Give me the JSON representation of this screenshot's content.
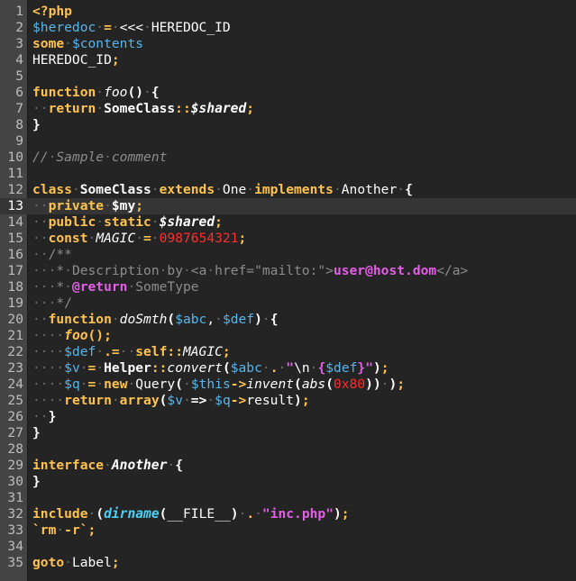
{
  "window": {
    "title": ""
  },
  "code_lines": [
    {
      "n": "1",
      "html": "<span class='kw'>&lt;?php</span>"
    },
    {
      "n": "2",
      "html": "<span class='var'>$heredoc</span><span class='ws'>·</span><span class='kw'>=</span><span class='ws'>·</span><span class='pl'>&lt;&lt;&lt;</span><span class='ws'>·</span><span class='pl'>HEREDOC_ID</span>"
    },
    {
      "n": "3",
      "html": "<span class='kw'>some</span><span class='ws'>·</span><span class='var'>$contents</span>"
    },
    {
      "n": "4",
      "html": "<span class='pl'>HEREDOC_ID</span><span class='kw'>;</span>"
    },
    {
      "n": "5",
      "html": ""
    },
    {
      "n": "6",
      "html": "<span class='kw'>function</span><span class='ws'>·</span><span class='pl it'>foo</span><span class='pl b'>()</span><span class='ws'>·</span><span class='pl b'>{</span>"
    },
    {
      "n": "7",
      "html": "<span class='ws'>··</span><span class='kw'>return</span><span class='ws'>·</span><span class='pl b'>SomeClass</span><span class='kw'>::</span><span class='pl it b'>$shared</span><span class='kw'>;</span>"
    },
    {
      "n": "8",
      "html": "<span class='pl b'>}</span>"
    },
    {
      "n": "9",
      "html": ""
    },
    {
      "n": "10",
      "html": "<span class='cm it'>//</span><span class='ws'>·</span><span class='cm it'>Sample</span><span class='ws'>·</span><span class='cm it'>comment</span>"
    },
    {
      "n": "11",
      "html": ""
    },
    {
      "n": "12",
      "html": "<span class='kw'>class</span><span class='ws'>·</span><span class='pl b'>SomeClass</span><span class='ws'>·</span><span class='kw'>extends</span><span class='ws'>·</span><span class='pl'>One</span><span class='ws'>·</span><span class='kw'>implements</span><span class='ws'>·</span><span class='pl'>Another</span><span class='ws'>·</span><span class='pl b'>{</span>"
    },
    {
      "n": "13",
      "html": "<span class='ws'>··</span><span class='kw'>private</span><span class='ws'>·</span><span class='pl b'>$my</span><span class='kw'>;</span>"
    },
    {
      "n": "14",
      "html": "<span class='ws'>··</span><span class='kw'>public</span><span class='ws'>·</span><span class='kw'>static</span><span class='ws'>·</span><span class='pl it b'>$shared</span><span class='kw'>;</span>"
    },
    {
      "n": "15",
      "html": "<span class='ws'>··</span><span class='kw'>const</span><span class='ws'>·</span><span class='pl it'>MAGIC</span><span class='ws'>·</span><span class='kw'>=</span><span class='ws'>·</span><span class='num'>0987654321</span><span class='kw'>;</span>"
    },
    {
      "n": "16",
      "html": "<span class='ws'>··</span><span class='cm'>/**</span>"
    },
    {
      "n": "17",
      "html": "<span class='ws'>···</span><span class='cm'>*</span><span class='ws'>·</span><span class='cm'>Description</span><span class='ws'>·</span><span class='cm'>by</span><span class='ws'>·</span><span class='cm'>&lt;a</span><span class='ws'>·</span><span class='cm'>href=\"mailto:\"&gt;</span><span class='str'>user@host.dom</span><span class='cm'>&lt;/a&gt;</span>"
    },
    {
      "n": "18",
      "html": "<span class='ws'>···</span><span class='cm'>*</span><span class='ws'>·</span><span class='str'>@return</span><span class='ws'>·</span><span class='cm'>SomeType</span>"
    },
    {
      "n": "19",
      "html": "<span class='ws'>···</span><span class='cm'>*/</span>"
    },
    {
      "n": "20",
      "html": "<span class='ws'>··</span><span class='kw'>function</span><span class='ws'>·</span><span class='pl it'>doSmth</span><span class='pl b'>(</span><span class='var'>$abc</span><span class='pl'>,</span><span class='ws'>·</span><span class='var'>$def</span><span class='pl b'>)</span><span class='ws'>·</span><span class='pl b'>{</span>"
    },
    {
      "n": "21",
      "html": "<span class='ws'>····</span><span class='kw it'>foo</span><span class='kw'>();</span>"
    },
    {
      "n": "22",
      "html": "<span class='ws'>····</span><span class='var'>$def</span><span class='ws'>·</span><span class='kw'>.=</span><span class='ws'>··</span><span class='kw'>self::</span><span class='pl it'>MAGIC</span><span class='kw'>;</span>"
    },
    {
      "n": "23",
      "html": "<span class='ws'>····</span><span class='var'>$v</span><span class='ws'>·</span><span class='kw'>=</span><span class='ws'>·</span><span class='pl b'>Helper</span><span class='kw'>::</span><span class='pl it'>convert</span><span class='pl b'>(</span><span class='var'>$abc</span><span class='ws'>·</span><span class='kw'>.</span><span class='ws'>·</span><span class='str'>\"</span><span class='pl'>\\n</span><span class='ws'>·</span><span class='str'>{</span><span class='var'>$def</span><span class='str'>}\"</span><span class='pl b'>)</span><span class='kw'>;</span>"
    },
    {
      "n": "24",
      "html": "<span class='ws'>····</span><span class='var'>$q</span><span class='ws'>·</span><span class='kw'>=</span><span class='ws'>·</span><span class='kw'>new</span><span class='ws'>·</span><span class='pl'>Query</span><span class='pl b'>(</span><span class='ws'>·</span><span class='var'>$this</span><span class='kw'>-&gt;</span><span class='pl it'>invent</span><span class='pl b'>(</span><span class='pl it'>abs</span><span class='pl b'>(</span><span class='num'>0x80</span><span class='pl b'>))</span><span class='ws'>·</span><span class='pl b'>)</span><span class='kw'>;</span>"
    },
    {
      "n": "25",
      "html": "<span class='ws'>····</span><span class='kw'>return</span><span class='ws'>·</span><span class='kw'>array</span><span class='pl b'>(</span><span class='var'>$v</span><span class='ws'>·</span><span class='pl b'>=&gt;</span><span class='ws'>·</span><span class='var'>$q</span><span class='kw'>-&gt;</span><span class='pl'>result</span><span class='pl b'>)</span><span class='kw'>;</span>"
    },
    {
      "n": "26",
      "html": "<span class='ws'>··</span><span class='pl b'>}</span>"
    },
    {
      "n": "27",
      "html": "<span class='pl b'>}</span>"
    },
    {
      "n": "28",
      "html": ""
    },
    {
      "n": "29",
      "html": "<span class='kw'>interface</span><span class='ws'>·</span><span class='pl it b'>Another</span><span class='ws'>·</span><span class='pl b'>{</span>"
    },
    {
      "n": "30",
      "html": "<span class='pl b'>}</span>"
    },
    {
      "n": "31",
      "html": ""
    },
    {
      "n": "32",
      "html": "<span class='kw'>include</span><span class='ws'>·</span><span class='pl b'>(</span><span class='fn it'>dirname</span><span class='pl b'>(</span><span class='pl'>__FILE__</span><span class='pl b'>)</span><span class='ws'>·</span><span class='kw'>.</span><span class='ws'>·</span><span class='str'>\"inc.php\"</span><span class='pl b'>)</span><span class='kw'>;</span>"
    },
    {
      "n": "33",
      "html": "<span class='kw'>`rm</span><span class='ws'>·</span><span class='kw'>-r`</span><span class='kw'>;</span>"
    },
    {
      "n": "34",
      "html": ""
    },
    {
      "n": "35",
      "html": "<span class='kw'>goto</span><span class='ws'>·</span><span class='pl'>Label</span><span class='kw'>;</span>"
    }
  ],
  "current_line": "13",
  "colors": {
    "background": "#242424",
    "gutter": "#444444",
    "keyword": "#ffc34d",
    "variable": "#58b6ea",
    "string": "#e45ee8",
    "comment": "#8c8c8c",
    "number": "#ff2d2d"
  }
}
